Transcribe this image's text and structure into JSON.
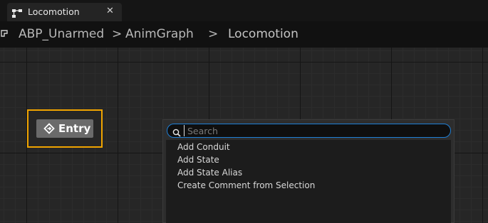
{
  "tab": {
    "icon": "state-machine-icon",
    "title": "Locomotion",
    "close": "✕"
  },
  "breadcrumb": {
    "items": [
      "ABP_Unarmed",
      "AnimGraph",
      "Locomotion"
    ],
    "separator": ">"
  },
  "graph": {
    "entry_node": {
      "icon": "entry-diamond-icon",
      "label": "Entry",
      "border_color": "#f0a400"
    }
  },
  "context_menu": {
    "search": {
      "placeholder": "Search",
      "value": ""
    },
    "items": [
      "Add Conduit",
      "Add State",
      "Add State Alias",
      "Create Comment from Selection"
    ],
    "focus_color": "#1e7fd6"
  }
}
